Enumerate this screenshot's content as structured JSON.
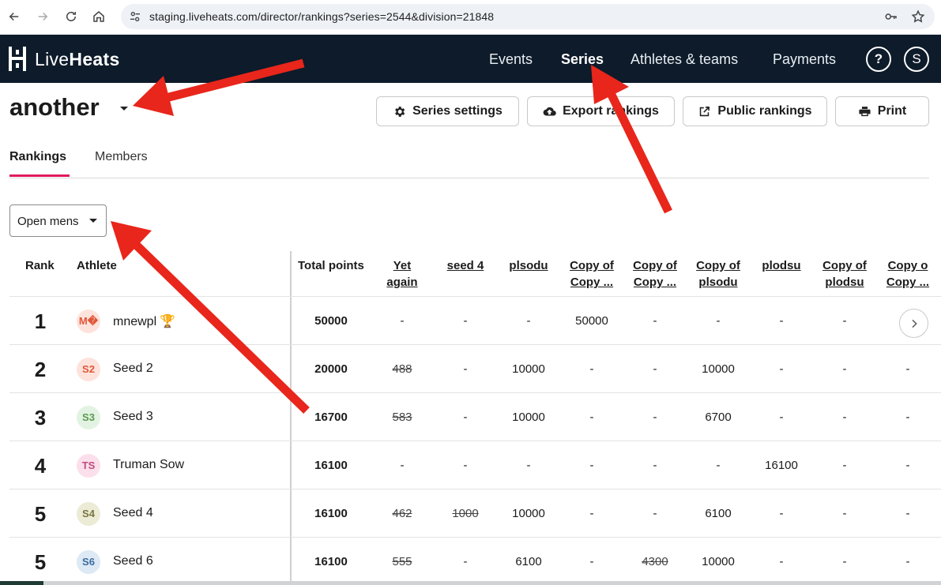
{
  "browser": {
    "url": "staging.liveheats.com/director/rankings?series=2544&division=21848"
  },
  "app": {
    "logo_light": "Live",
    "logo_bold": "Heats",
    "nav": [
      {
        "label": "Events"
      },
      {
        "label": "Series"
      },
      {
        "label": "Athletes & teams"
      },
      {
        "label": "Payments"
      }
    ],
    "help_label": "?",
    "user_initial": "S"
  },
  "page": {
    "title": "another",
    "buttons": {
      "series_settings": "Series settings",
      "export_rankings": "Export rankings",
      "public_rankings": "Public rankings",
      "print": "Print"
    },
    "tabs": [
      "Rankings",
      "Members"
    ],
    "division": "Open mens"
  },
  "table": {
    "headers": {
      "rank": "Rank",
      "athlete": "Athlete",
      "total": "Total points"
    },
    "event_columns": [
      {
        "line1": "Yet",
        "line2": "again"
      },
      {
        "line1": "seed 4",
        "line2": ""
      },
      {
        "line1": "plsodu",
        "line2": ""
      },
      {
        "line1": "Copy of",
        "line2": "Copy ..."
      },
      {
        "line1": "Copy of",
        "line2": "Copy ..."
      },
      {
        "line1": "Copy of",
        "line2": "plsodu"
      },
      {
        "line1": "plodsu",
        "line2": ""
      },
      {
        "line1": "Copy of",
        "line2": "plodsu"
      },
      {
        "line1": "Copy o",
        "line2": "Copy ..."
      }
    ],
    "rows": [
      {
        "rank": "1",
        "initials": "M�",
        "name": "mnewpl",
        "trophy": "🏆",
        "total": "50000",
        "avatar_bg": "#fde3dc",
        "avatar_fg": "#e0583a",
        "cells": [
          "-",
          "-",
          "-",
          "50000",
          "-",
          "-",
          "-",
          "-"
        ]
      },
      {
        "rank": "2",
        "initials": "S2",
        "name": "Seed 2",
        "trophy": "",
        "total": "20000",
        "avatar_bg": "#fde3dc",
        "avatar_fg": "#e0583a",
        "cells": [
          "488",
          "-",
          "10000",
          "-",
          "-",
          "10000",
          "-",
          "-",
          "-"
        ]
      },
      {
        "rank": "3",
        "initials": "S3",
        "name": "Seed 3",
        "trophy": "",
        "total": "16700",
        "avatar_bg": "#e3f3e3",
        "avatar_fg": "#5a9a4f",
        "cells": [
          "583",
          "-",
          "10000",
          "-",
          "-",
          "6700",
          "-",
          "-",
          "-"
        ]
      },
      {
        "rank": "4",
        "initials": "TS",
        "name": "Truman Sow",
        "trophy": "",
        "total": "16100",
        "avatar_bg": "#fbe0ec",
        "avatar_fg": "#c04b7e",
        "cells": [
          "-",
          "-",
          "-",
          "-",
          "-",
          "-",
          "16100",
          "-",
          "-"
        ]
      },
      {
        "rank": "5",
        "initials": "S4",
        "name": "Seed 4",
        "trophy": "",
        "total": "16100",
        "avatar_bg": "#ecebd6",
        "avatar_fg": "#7a7440",
        "cells": [
          "462",
          "1000",
          "10000",
          "-",
          "-",
          "6100",
          "-",
          "-",
          "-"
        ]
      },
      {
        "rank": "5",
        "initials": "S6",
        "name": "Seed 6",
        "trophy": "",
        "total": "16100",
        "avatar_bg": "#dde9f5",
        "avatar_fg": "#3b6c9e",
        "cells": [
          "555",
          "-",
          "6100",
          "-",
          "4300",
          "10000",
          "-",
          "-",
          "-"
        ]
      }
    ]
  },
  "colors": {
    "header_bg": "#0d1b2a",
    "tab_accent": "#e01a5f",
    "arrow": "#e8261b"
  },
  "icons": [
    "back-arrow-icon",
    "forward-arrow-icon",
    "reload-icon",
    "home-icon",
    "site-settings-icon",
    "key-icon",
    "star-icon",
    "gear-icon",
    "cloud-upload-icon",
    "external-link-icon",
    "printer-icon",
    "chevron-right-icon",
    "chevron-down-icon"
  ]
}
